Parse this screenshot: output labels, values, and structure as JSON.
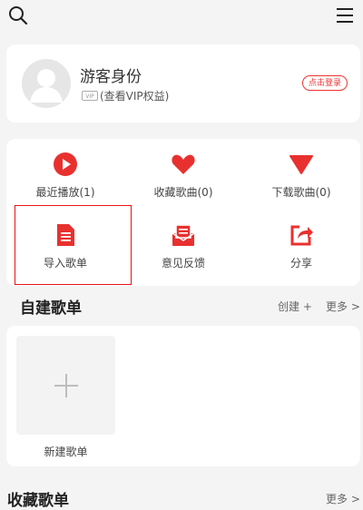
{
  "topbar": {
    "search_icon": "search-icon",
    "menu_icon": "menu-icon"
  },
  "profile": {
    "name": "游客身份",
    "vip_badge": "VIP",
    "vip_text": "(查看VIP权益)",
    "login_label": "点击登录"
  },
  "grid": {
    "items": [
      {
        "label": "最近播放(1)",
        "icon": "play-icon"
      },
      {
        "label": "收藏歌曲(0)",
        "icon": "heart-icon"
      },
      {
        "label": "下载歌曲(0)",
        "icon": "download-triangle-icon"
      },
      {
        "label": "导入歌单",
        "icon": "document-icon"
      },
      {
        "label": "意见反馈",
        "icon": "feedback-icon"
      },
      {
        "label": "分享",
        "icon": "share-icon"
      }
    ]
  },
  "created_playlists": {
    "title": "自建歌单",
    "create_label": "创建 +",
    "more_label": "更多 >",
    "new_label": "新建歌单"
  },
  "collected_playlists": {
    "title": "收藏歌单",
    "more_label": "更多 >"
  },
  "colors": {
    "accent": "#e8312f",
    "background": "#f4f4f4"
  }
}
